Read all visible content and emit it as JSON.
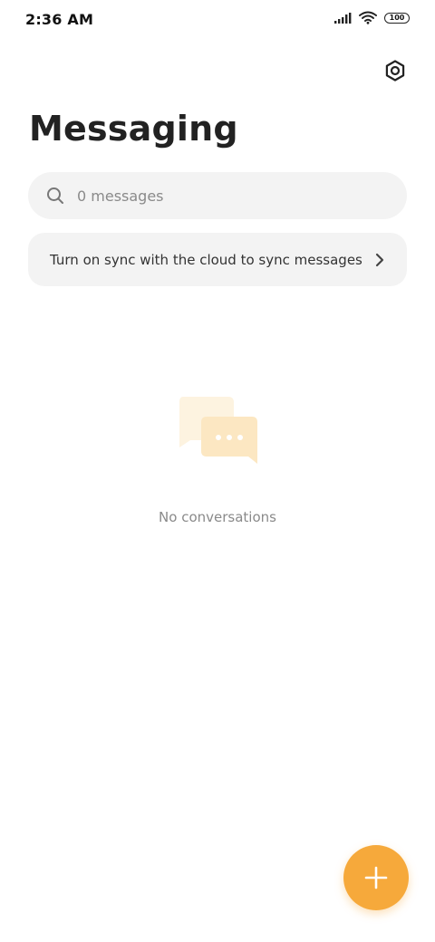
{
  "status_bar": {
    "time": "2:36 AM",
    "battery": "100",
    "icons": [
      "signal-icon",
      "wifi-icon",
      "battery-icon"
    ]
  },
  "header": {
    "title": "Messaging",
    "settings_icon": "gear-icon"
  },
  "search": {
    "placeholder": "0 messages",
    "value": ""
  },
  "sync_banner": {
    "text": "Turn on sync with the cloud to sync messages",
    "icon": "chevron-right-icon"
  },
  "empty_state": {
    "icon": "chat-bubbles-icon",
    "text": "No conversations"
  },
  "fab": {
    "icon": "plus-icon"
  },
  "colors": {
    "accent": "#f6a93b",
    "surface": "#f3f3f3",
    "illustration_light": "#fdf3e0",
    "illustration_mid": "#fce7c2"
  }
}
